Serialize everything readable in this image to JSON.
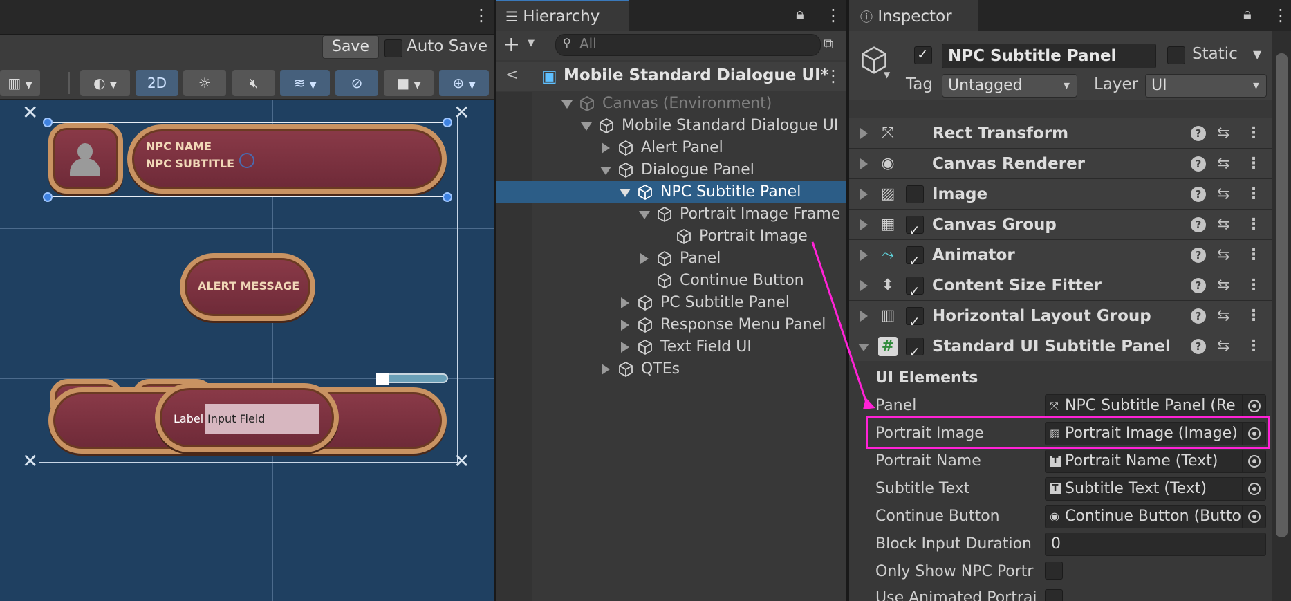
{
  "scene": {
    "save_label": "Save",
    "autosave_label": "Auto Save",
    "toolbar": {
      "mode_2d": "2D"
    },
    "canvas_texts": {
      "npc_name": "NPC NAME",
      "npc_subtitle": "NPC SUBTITLE",
      "alert_message": "ALERT MESSAGE",
      "label": "Label",
      "input_field": "Input Field"
    }
  },
  "hierarchy": {
    "tab_label": "Hierarchy",
    "search_placeholder": "All",
    "scene_name": "Mobile Standard Dialogue UI*",
    "items": [
      {
        "label": "Canvas (Environment)"
      },
      {
        "label": "Mobile Standard Dialogue UI"
      },
      {
        "label": "Alert Panel"
      },
      {
        "label": "Dialogue Panel"
      },
      {
        "label": "NPC Subtitle Panel"
      },
      {
        "label": "Portrait Image Frame"
      },
      {
        "label": "Portrait Image"
      },
      {
        "label": "Panel"
      },
      {
        "label": "Continue Button"
      },
      {
        "label": "PC Subtitle Panel"
      },
      {
        "label": "Response Menu Panel"
      },
      {
        "label": "Text Field UI"
      },
      {
        "label": "QTEs"
      }
    ]
  },
  "inspector": {
    "tab_label": "Inspector",
    "object_name": "NPC Subtitle Panel",
    "static_label": "Static",
    "tag_label": "Tag",
    "tag_value": "Untagged",
    "layer_label": "Layer",
    "layer_value": "UI",
    "components": [
      {
        "name": "Rect Transform",
        "icon": "rect-transform-icon"
      },
      {
        "name": "Canvas Renderer",
        "icon": "eye-icon"
      },
      {
        "name": "Image",
        "icon": "image-icon"
      },
      {
        "name": "Canvas Group",
        "icon": "grid-icon"
      },
      {
        "name": "Animator",
        "icon": "animator-icon"
      },
      {
        "name": "Content Size Fitter",
        "icon": "fitter-icon"
      },
      {
        "name": "Horizontal Layout Group",
        "icon": "layout-icon"
      },
      {
        "name": "Standard UI Subtitle Panel",
        "icon": "script-icon"
      }
    ],
    "section_title": "UI Elements",
    "properties": [
      {
        "label": "Panel",
        "value": "NPC Subtitle Panel (Re"
      },
      {
        "label": "Portrait Image",
        "value": "Portrait Image (Image)"
      },
      {
        "label": "Portrait Name",
        "value": "Portrait Name (Text)"
      },
      {
        "label": "Subtitle Text",
        "value": "Subtitle Text (Text)"
      },
      {
        "label": "Continue Button",
        "value": "Continue Button (Butto"
      },
      {
        "label": "Block Input Duration",
        "value": "0"
      },
      {
        "label": "Only Show NPC Portr",
        "value": ""
      },
      {
        "label": "Use Animated Portrai",
        "value": ""
      }
    ]
  },
  "colors": {
    "highlight": "#ff22d6",
    "selection": "#2c5d87",
    "scene_bg": "#1f4061"
  }
}
